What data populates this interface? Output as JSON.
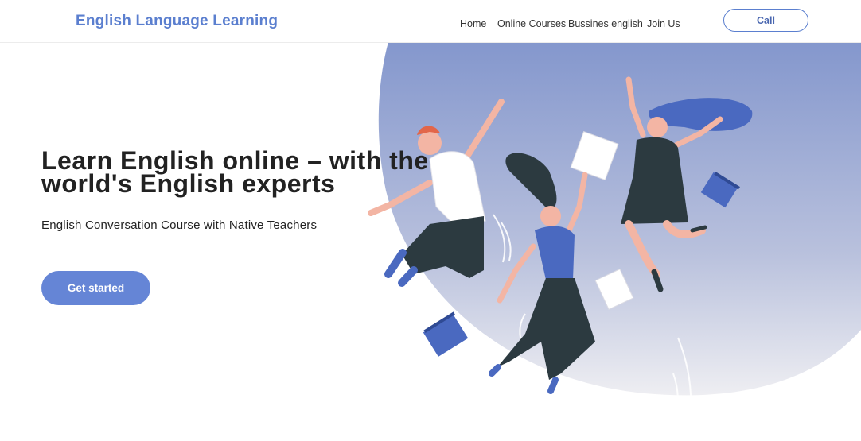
{
  "header": {
    "brand": "English Language Learning",
    "nav": [
      "Home",
      "Online Courses",
      "Bussines english",
      "Join Us"
    ],
    "call_label": "Call"
  },
  "hero": {
    "headline_line1": "Learn English online – with the",
    "headline_line2": "world's English experts",
    "subtitle": "English Conversation Course with Native Teachers",
    "cta_label": "Get started"
  },
  "colors": {
    "accent": "#5b7fcf",
    "button": "#6585d6",
    "blob_top": "#8497cd",
    "blob_bottom": "#ecedf1",
    "shirt_blue": "#4a69c0",
    "dark_outfit": "#2c3a40"
  }
}
